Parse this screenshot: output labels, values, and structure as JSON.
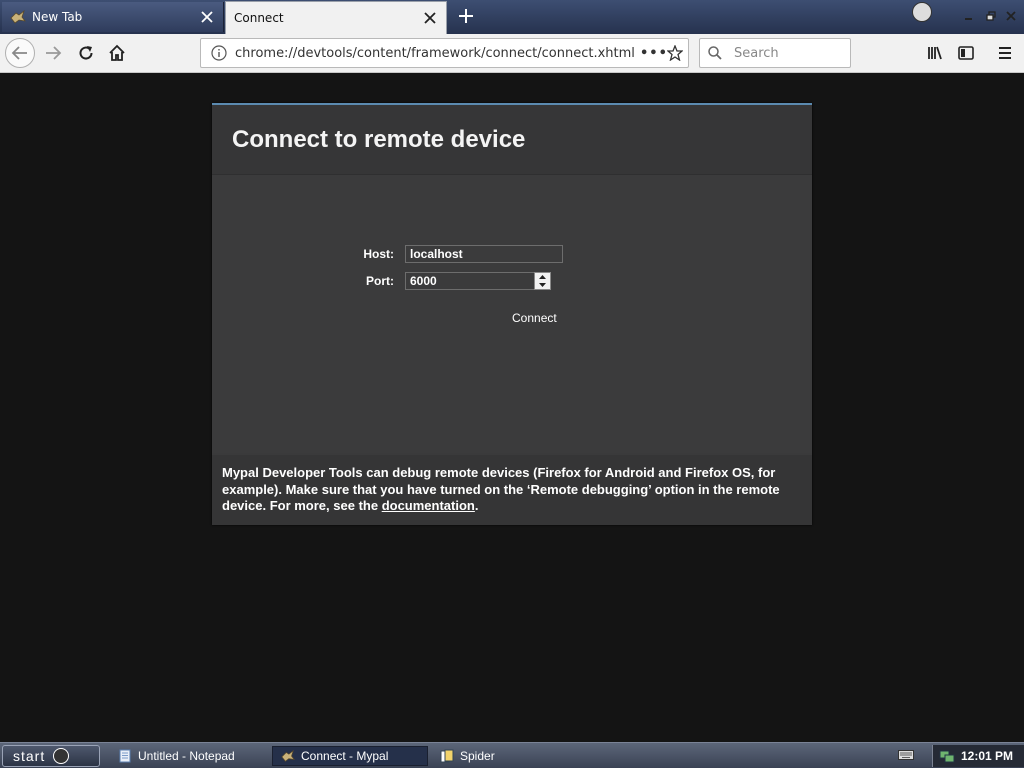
{
  "browser": {
    "tabs": [
      {
        "label": "New Tab",
        "active": false
      },
      {
        "label": "Connect",
        "active": true
      }
    ],
    "url": "chrome://devtools/content/framework/connect/connect.xhtml",
    "search_placeholder": "Search",
    "page_actions_label": "•••"
  },
  "page": {
    "title": "Connect to remote device",
    "host_label": "Host:",
    "host_value": "localhost",
    "port_label": "Port:",
    "port_value": "6000",
    "connect_label": "Connect",
    "footer_text": "Mypal Developer Tools can debug remote devices (Firefox for Android and Firefox OS, for example). Make sure that you have turned on the ‘Remote debugging’ option in the remote device. For more, see the ",
    "footer_link": "documentation",
    "footer_end": "."
  },
  "taskbar": {
    "start_label": "start",
    "tasks": [
      {
        "label": "Untitled - Notepad",
        "active": false
      },
      {
        "label": "Connect - Mypal",
        "active": true
      },
      {
        "label": "Spider",
        "active": false
      }
    ],
    "clock": "12:01 PM"
  },
  "colors": {
    "accent": "#5b8ab0",
    "panel": "#3a3a3b",
    "page_bg": "#141414",
    "titlebar": "#26324e"
  }
}
